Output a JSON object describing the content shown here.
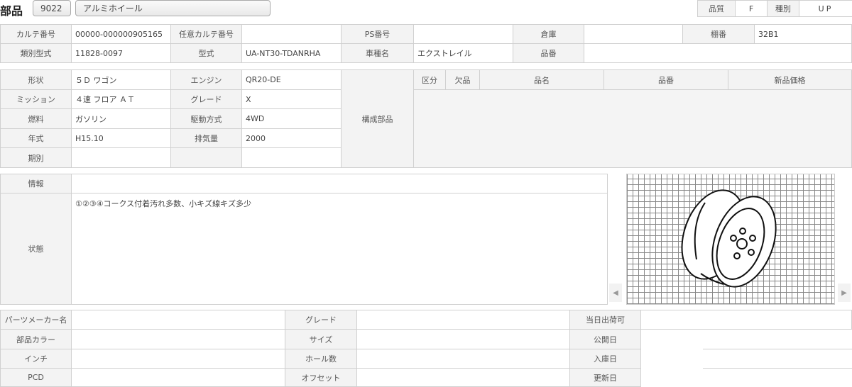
{
  "header": {
    "title": "部品",
    "part_code": "9022",
    "part_name": "アルミホイール",
    "quality_label": "品質",
    "quality_value": "F",
    "type_label": "種別",
    "type_value": "UP"
  },
  "info1": {
    "karte_no_label": "カルテ番号",
    "karte_no": "00000-000000905165",
    "opt_karte_label": "任意カルテ番号",
    "opt_karte": "",
    "ps_label": "PS番号",
    "ps": "",
    "warehouse_label": "倉庫",
    "warehouse": "",
    "shelf_label": "棚番",
    "shelf": "32B1",
    "class_model_label": "類別型式",
    "class_model": "11828-0097",
    "model_label": "型式",
    "model": "UA-NT30-TDANRHA",
    "car_label": "車種名",
    "car": "エクストレイル",
    "partno_label": "品番",
    "partno": ""
  },
  "info2": {
    "shape_label": "形状",
    "shape": "５Ｄ ワゴン",
    "engine_label": "エンジン",
    "engine": "QR20-DE",
    "mission_label": "ミッション",
    "mission": "４速 フロア ＡＴ",
    "grade_label": "グレード",
    "grade": "X",
    "fuel_label": "燃料",
    "fuel": "ガソリン",
    "drive_label": "駆動方式",
    "drive": "4WD",
    "year_label": "年式",
    "year": "H15.10",
    "displacement_label": "排気量",
    "displacement": "2000",
    "period_label": "期別",
    "period": "",
    "components_label": "構成部品"
  },
  "components": {
    "columns": [
      "区分",
      "欠品",
      "品名",
      "品番",
      "新品価格"
    ],
    "rows": []
  },
  "details": {
    "info_label": "情報",
    "info": "",
    "state_label": "状態",
    "state": "①②③④コークス付着汚れ多数、小キズ線キズ多少"
  },
  "image": {
    "alt_icon": "wheel-diagram",
    "prev": "◀",
    "next": "▶"
  },
  "bottom": {
    "maker_label": "パーツメーカー名",
    "maker": "",
    "color_label": "部品カラー",
    "color": "",
    "inch_label": "インチ",
    "inch": "",
    "pcd_label": "PCD",
    "pcd": "",
    "grade_label": "グレード",
    "grade": "",
    "size_label": "サイズ",
    "size": "",
    "holes_label": "ホール数",
    "holes": "",
    "offset_label": "オフセット",
    "offset": "",
    "sameday_label": "当日出荷可",
    "sameday": "",
    "public_label": "公開日",
    "public": "",
    "stock_label": "入庫日",
    "stock": "",
    "updated_label": "更新日",
    "updated": ""
  }
}
